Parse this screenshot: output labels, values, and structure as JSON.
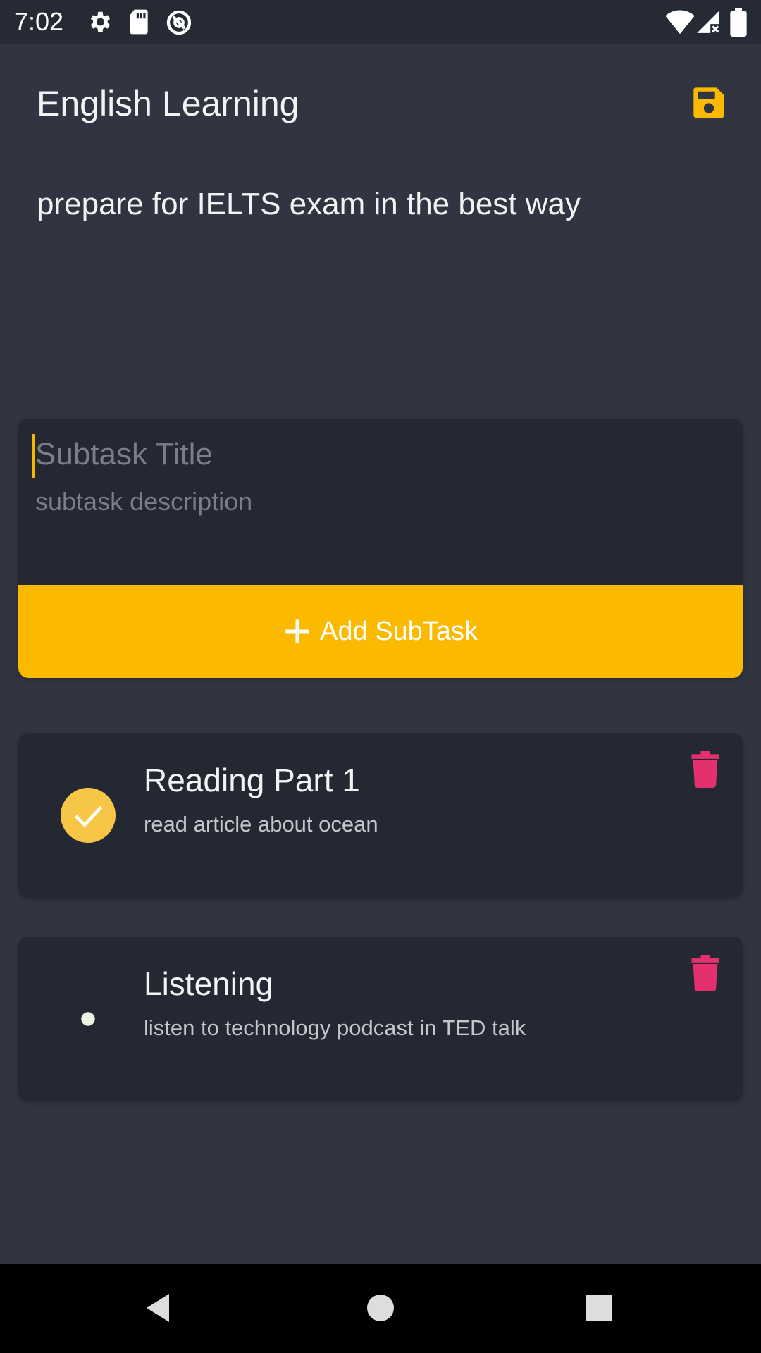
{
  "status_bar": {
    "time": "7:02",
    "icons": [
      "settings-icon",
      "sd-card-icon",
      "data-saver-icon",
      "wifi-icon",
      "signal-icon",
      "battery-icon"
    ]
  },
  "task": {
    "title": "English Learning",
    "description": "prepare for IELTS exam in the best way",
    "save_icon": "save-icon"
  },
  "new_subtask": {
    "title_placeholder": "Subtask Title",
    "description_placeholder": "subtask description",
    "add_button_label": "Add SubTask"
  },
  "subtasks": [
    {
      "title": "Reading Part 1",
      "description": "read article about ocean",
      "completed": true
    },
    {
      "title": "Listening",
      "description": "listen to technology podcast in TED talk",
      "completed": false
    }
  ],
  "colors": {
    "background": "#313542",
    "card": "#242833",
    "accent": "#fbb900",
    "check": "#f7c646",
    "delete": "#e5306f"
  },
  "nav_bar": {
    "icons": [
      "back-icon",
      "home-icon",
      "recents-icon"
    ]
  }
}
